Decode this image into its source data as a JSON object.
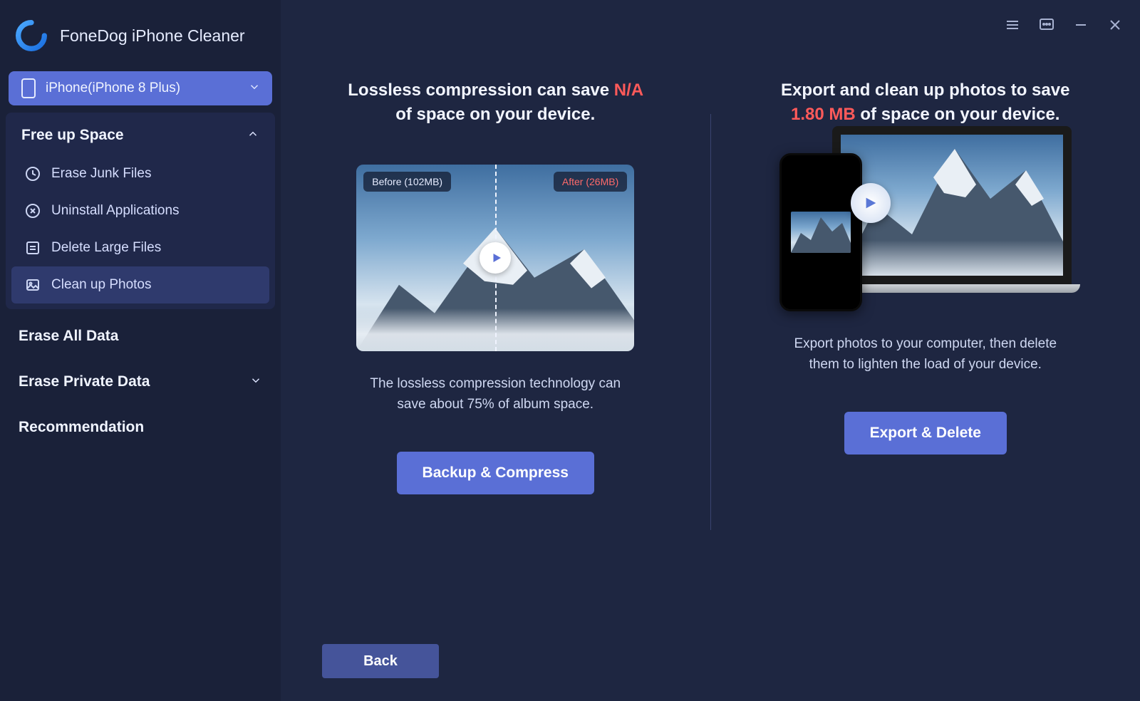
{
  "app": {
    "title": "FoneDog iPhone Cleaner"
  },
  "device": {
    "label": "iPhone(iPhone 8 Plus)"
  },
  "sidebar": {
    "freeUpSpace": {
      "title": "Free up Space",
      "items": [
        {
          "label": "Erase Junk Files"
        },
        {
          "label": "Uninstall Applications"
        },
        {
          "label": "Delete Large Files"
        },
        {
          "label": "Clean up Photos"
        }
      ]
    },
    "eraseAll": "Erase All Data",
    "erasePrivate": "Erase Private Data",
    "recommendation": "Recommendation"
  },
  "main": {
    "left": {
      "headlinePre": "Lossless compression can save ",
      "headlineAccent": "N/A",
      "headlinePost": " of space on your device.",
      "beforeBadge": "Before (102MB)",
      "afterBadge": "After (26MB)",
      "sub": "The lossless compression technology can save about 75% of album space.",
      "button": "Backup & Compress"
    },
    "right": {
      "headlinePre": "Export and clean up photos to save ",
      "headlineAccent": "1.80 MB",
      "headlinePost": " of space on your device.",
      "sub": "Export photos to your computer, then delete them to lighten the load of your device.",
      "button": "Export & Delete"
    },
    "back": "Back"
  }
}
